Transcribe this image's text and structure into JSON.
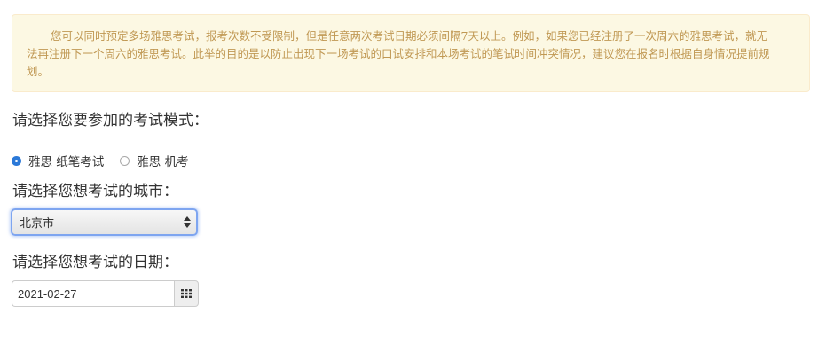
{
  "notice": {
    "text": "您可以同时预定多场雅思考试，报考次数不受限制，但是任意两次考试日期必须间隔7天以上。例如，如果您已经注册了一次周六的雅思考试，就无法再注册下一个周六的雅思考试。此举的目的是以防止出现下一场考试的口试安排和本场考试的笔试时间冲突情况，建议您在报名时根据自身情况提前规划。"
  },
  "exam_mode": {
    "label": "请选择您要参加的考试模式：",
    "options": [
      {
        "label": "雅思 纸笔考试",
        "checked": true
      },
      {
        "label": "雅思 机考",
        "checked": false
      }
    ]
  },
  "city": {
    "label": "请选择您想考试的城市：",
    "selected": "北京市"
  },
  "date": {
    "label": "请选择您想考试的日期：",
    "value": "2021-02-27",
    "button_icon": "calendar-grid-icon"
  },
  "colors": {
    "notice_bg": "#fcf8e3",
    "notice_text": "#c09853",
    "radio_checked": "#2b79d8",
    "focus_ring": "#7ea5f0"
  }
}
